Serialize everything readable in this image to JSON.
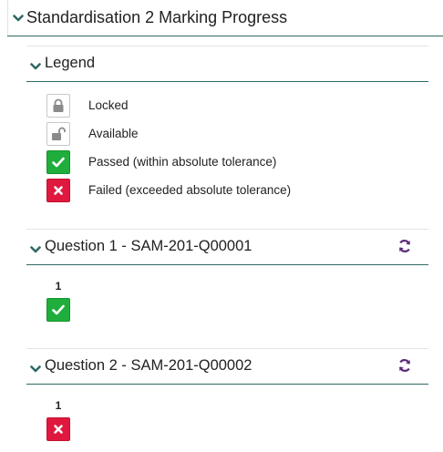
{
  "page": {
    "title": "Standardisation 2 Marking Progress"
  },
  "legend": {
    "heading": "Legend",
    "items": [
      {
        "icon": "lock-closed-icon",
        "label": "Locked"
      },
      {
        "icon": "lock-open-icon",
        "label": "Available"
      },
      {
        "icon": "check-icon",
        "label": "Passed (within absolute tolerance)"
      },
      {
        "icon": "cross-icon",
        "label": "Failed (exceeded absolute tolerance)"
      }
    ]
  },
  "questions": [
    {
      "title": "Question 1 - SAM-201-Q00001",
      "items": [
        {
          "number": "1",
          "status": "passed"
        }
      ]
    },
    {
      "title": "Question 2 - SAM-201-Q00002",
      "items": [
        {
          "number": "1",
          "status": "failed"
        }
      ]
    }
  ],
  "colors": {
    "accent": "#2f6a63",
    "passed": "#1fae3c",
    "failed": "#e0183f",
    "refresh": "#5a2a7a",
    "chevron": "#2f6a63"
  }
}
